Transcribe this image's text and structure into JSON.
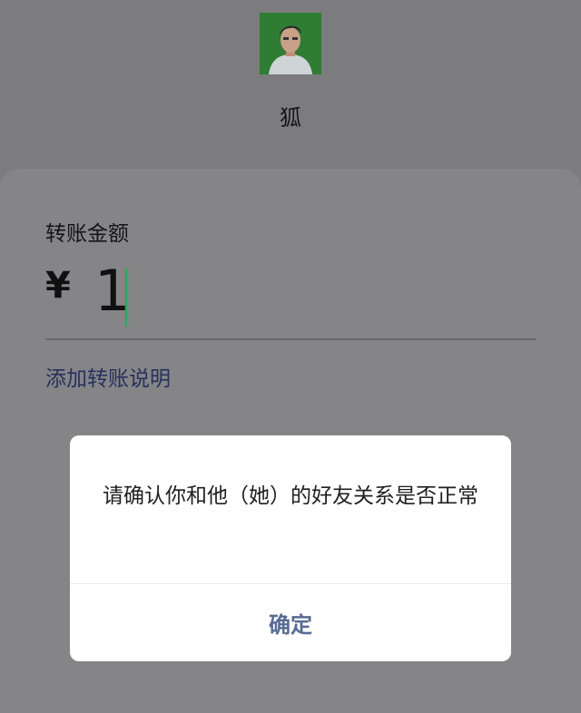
{
  "recipient": {
    "avatar_icon": "user-avatar-photo",
    "name": "狐"
  },
  "transfer": {
    "amount_label": "转账金额",
    "currency_symbol": "¥",
    "amount": "1",
    "add_note": "添加转账说明"
  },
  "dialog": {
    "message": "请确认你和他（她）的好友关系是否正常",
    "confirm_label": "确定"
  },
  "colors": {
    "overlay_background": "#7c7b7e",
    "link": "#576b95",
    "cursor": "#1aad5b"
  }
}
